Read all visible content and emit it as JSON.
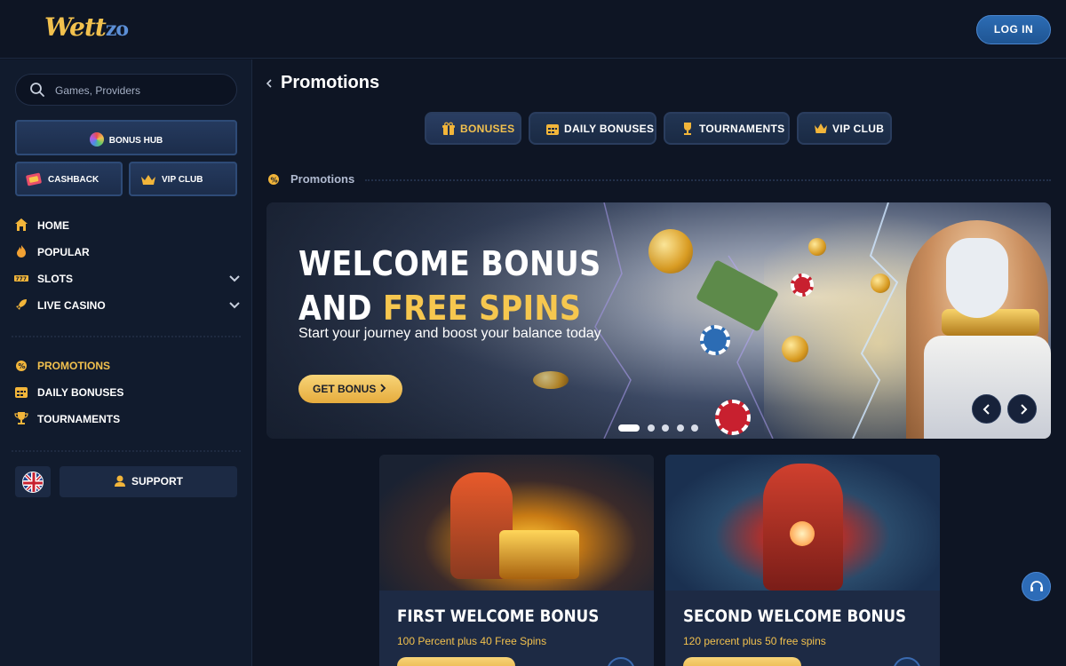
{
  "header": {
    "logo_main": "Wett",
    "logo_accent": "zo",
    "login_label": "LOG IN"
  },
  "sidebar": {
    "search_placeholder": "Games, Providers",
    "bonus_hub_label": "BONUS HUB",
    "cashback_label": "CASHBACK",
    "vip_label": "VIP CLUB",
    "nav_main": [
      {
        "label": "HOME",
        "icon": "home-icon"
      },
      {
        "label": "POPULAR",
        "icon": "fire-icon"
      },
      {
        "label": "SLOTS",
        "icon": "slot-reels-icon",
        "expandable": true
      },
      {
        "label": "LIVE CASINO",
        "icon": "rocket-icon",
        "expandable": true
      }
    ],
    "nav_secondary": [
      {
        "label": "PROMOTIONS",
        "icon": "promo-icon",
        "active": true
      },
      {
        "label": "DAILY BONUSES",
        "icon": "calendar-icon"
      },
      {
        "label": "TOURNAMENTS",
        "icon": "trophy-icon"
      }
    ],
    "support_label": "SUPPORT",
    "language_flag": "uk-flag-icon"
  },
  "main": {
    "page_title": "Promotions",
    "tabs": [
      {
        "label": "BONUSES",
        "icon": "gift-icon",
        "active": true
      },
      {
        "label": "DAILY BONUSES",
        "icon": "calendar-icon"
      },
      {
        "label": "TOURNAMENTS",
        "icon": "trophy-icon"
      },
      {
        "label": "VIP CLUB",
        "icon": "crown-icon"
      }
    ],
    "section_label": "Promotions",
    "hero": {
      "line1": "WELCOME BONUS",
      "line2_prefix": "AND ",
      "line2_highlight": "FREE SPINS",
      "subtitle": "Start your journey and boost your balance today",
      "cta_label": "GET BONUS",
      "slide_count": 5,
      "active_slide": 1
    },
    "cards": [
      {
        "title": "FIRST WELCOME BONUS",
        "description": "100 Percent plus 40 Free Spins"
      },
      {
        "title": "SECOND WELCOME BONUS",
        "description": "120 percent plus 50 free spins"
      }
    ]
  },
  "colors": {
    "accent_gold": "#f2c14e",
    "background": "#0e1524",
    "primary_blue": "#2c6cb4"
  }
}
